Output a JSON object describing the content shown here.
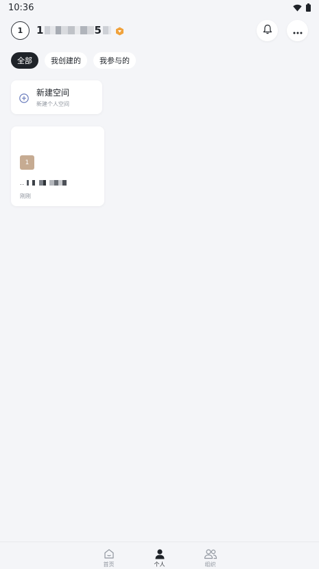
{
  "status_bar": {
    "time": "10:36",
    "icons": [
      "wifi-icon",
      "battery-icon"
    ]
  },
  "header": {
    "avatar_text": "1",
    "user_name_visible": "1",
    "user_name_tail": "5",
    "badge_icon": "vip-hexagon-icon",
    "badge_color": "#f0a23c",
    "actions": [
      "bell-icon",
      "more-icon"
    ]
  },
  "tabs": [
    {
      "label": "全部",
      "active": true
    },
    {
      "label": "我创建的",
      "active": false
    },
    {
      "label": "我参与的",
      "active": false
    }
  ],
  "new_space": {
    "title": "新建空间",
    "subtitle": "新建个人空间",
    "icon": "plus-circle-icon",
    "icon_color": "#5b6fb5"
  },
  "space_card": {
    "thumb_text": "1",
    "thumb_color": "#c6ab92",
    "name_prefix": "..",
    "time": "刚刚"
  },
  "bottom_nav": [
    {
      "label": "首页",
      "icon": "home-icon",
      "active": false
    },
    {
      "label": "个人",
      "icon": "person-icon",
      "active": true
    },
    {
      "label": "组织",
      "icon": "group-icon",
      "active": false
    }
  ]
}
